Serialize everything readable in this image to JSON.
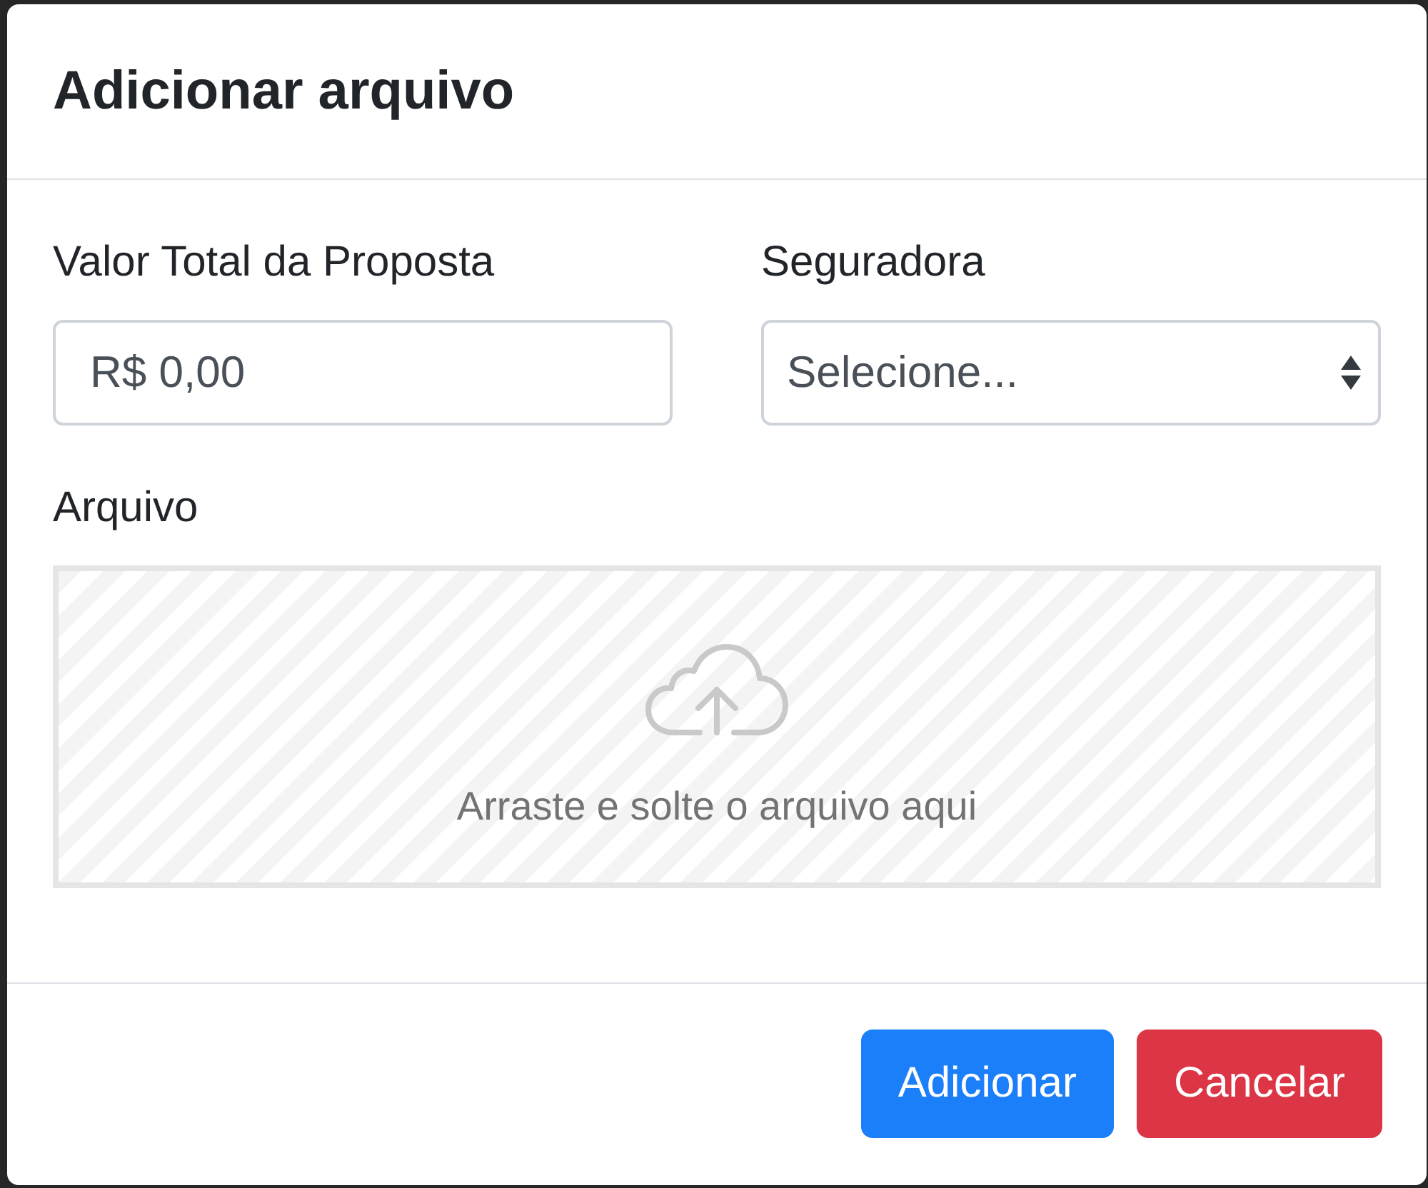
{
  "dialog": {
    "title": "Adicionar arquivo"
  },
  "fields": [
    {
      "kind": "text",
      "label": "Valor Total da Proposta",
      "value": "R$ 0,00"
    },
    {
      "kind": "select",
      "label": "Seguradora",
      "value": "Selecione..."
    }
  ],
  "upload": {
    "label": "Arquivo",
    "hint": "Arraste e solte o arquivo aqui"
  },
  "buttons": [
    {
      "kind": "primary",
      "label": "Adicionar"
    },
    {
      "kind": "danger",
      "label": "Cancelar"
    }
  ]
}
